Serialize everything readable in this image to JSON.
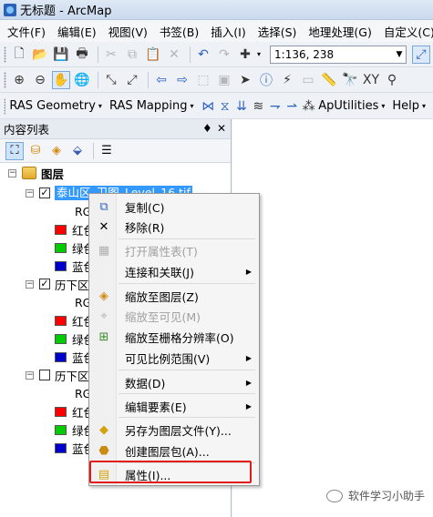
{
  "window": {
    "title": "无标题 - ArcMap"
  },
  "menubar": [
    "文件(F)",
    "编辑(E)",
    "视图(V)",
    "书签(B)",
    "插入(I)",
    "选择(S)",
    "地理处理(G)",
    "自定义(C)"
  ],
  "toolbar1": {
    "scale_value": "1:136, 238"
  },
  "toolbar3": {
    "ras_geometry": "RAS Geometry",
    "ras_mapping": "RAS Mapping",
    "ap_utilities": "ApUtilities",
    "help": "Help"
  },
  "toc": {
    "title": "内容列表",
    "pin": "♦",
    "close": "✕",
    "root_label": "图层",
    "layers": [
      {
        "label": "泰山区_卫图_Level_16.tif",
        "checked": true,
        "selected": true,
        "sub_label": "RG",
        "bands": [
          "红色",
          "绿色",
          "蓝色"
        ]
      },
      {
        "label": "历下区",
        "checked": true,
        "selected": false,
        "sub_label": "RG",
        "bands": [
          "红色",
          "绿色",
          "蓝色"
        ]
      },
      {
        "label": "历下区",
        "checked": false,
        "selected": false,
        "sub_label": "RG",
        "bands": [
          "红色",
          "绿色",
          "蓝色"
        ]
      }
    ],
    "band_colors": [
      "#ff0000",
      "#00cc00",
      "#0000cc"
    ]
  },
  "context_menu": {
    "items": [
      {
        "label": "复制(C)",
        "icon": "copy-icon",
        "disabled": false,
        "submenu": false
      },
      {
        "label": "移除(R)",
        "icon": "remove-icon",
        "disabled": false,
        "submenu": false
      },
      {
        "label": "打开属性表(T)",
        "icon": "table-icon",
        "disabled": true,
        "submenu": false
      },
      {
        "label": "连接和关联(J)",
        "icon": "",
        "disabled": false,
        "submenu": true
      },
      {
        "label": "缩放至图层(Z)",
        "icon": "zoom-layer-icon",
        "disabled": false,
        "submenu": false
      },
      {
        "label": "缩放至可见(M)",
        "icon": "zoom-visible-icon",
        "disabled": true,
        "submenu": false
      },
      {
        "label": "缩放至栅格分辨率(O)",
        "icon": "zoom-raster-icon",
        "disabled": false,
        "submenu": false
      },
      {
        "label": "可见比例范围(V)",
        "icon": "",
        "disabled": false,
        "submenu": true
      },
      {
        "label": "数据(D)",
        "icon": "",
        "disabled": false,
        "submenu": true
      },
      {
        "label": "编辑要素(E)",
        "icon": "",
        "disabled": false,
        "submenu": true
      },
      {
        "label": "另存为图层文件(Y)...",
        "icon": "save-layer-icon",
        "disabled": false,
        "submenu": false
      },
      {
        "label": "创建图层包(A)...",
        "icon": "layer-package-icon",
        "disabled": false,
        "submenu": false
      },
      {
        "label": "属性(I)...",
        "icon": "properties-icon",
        "disabled": false,
        "submenu": false
      }
    ],
    "highlighted_item": "属性(I)..."
  },
  "watermark": "软件学习小助手"
}
